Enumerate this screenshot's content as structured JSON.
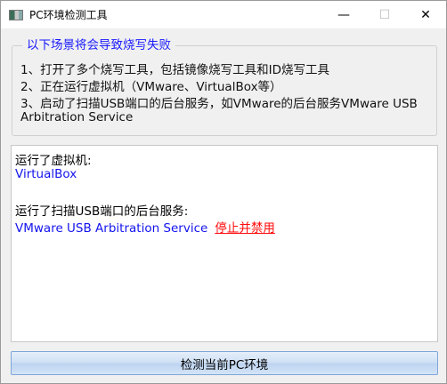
{
  "window": {
    "title": "PC环境检测工具",
    "minimize": "—",
    "maximize": "☐",
    "close": "✕"
  },
  "warning_group": {
    "title": "以下场景将会导致烧写失败",
    "lines": [
      "1、打开了多个烧写工具，包括镜像烧写工具和ID烧写工具",
      "2、正在运行虚拟机（VMware、VirtualBox等）",
      "3、启动了扫描USB端口的后台服务，如VMware的后台服务VMware USB",
      "Arbitration Service"
    ]
  },
  "results": {
    "vm_label": "运行了虚拟机:",
    "vm_value": "VirtualBox",
    "usb_label": "运行了扫描USB端口的后台服务:",
    "usb_value": "VMware USB Arbitration Service",
    "usb_action": "停止并禁用"
  },
  "button": {
    "label": "检测当前PC环境"
  },
  "colors": {
    "accent": "#1414ee",
    "danger": "#ff0a0a"
  }
}
